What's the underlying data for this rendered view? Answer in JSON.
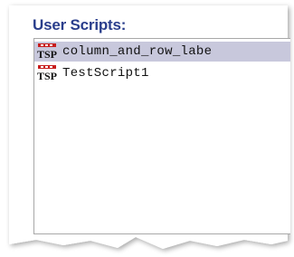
{
  "panel": {
    "title": "User Scripts:"
  },
  "scripts": [
    {
      "label": "column_and_row_labe",
      "icon": "tsp-script-icon",
      "icon_text": "TSP",
      "selected": true
    },
    {
      "label": "TestScript1",
      "icon": "tsp-script-icon",
      "icon_text": "TSP",
      "selected": false
    }
  ],
  "colors": {
    "title": "#2a3e8c",
    "selection": "#c8c8dc",
    "icon_red": "#c81e1e"
  }
}
